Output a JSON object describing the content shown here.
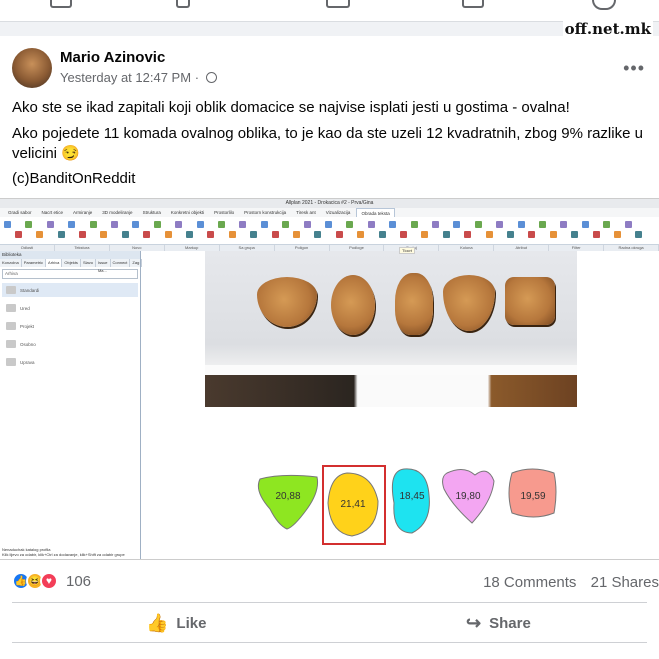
{
  "watermark": "off.net.mk",
  "post": {
    "author": "Mario Azinovic",
    "time": "Yesterday at 12:47 PM",
    "separator": "·",
    "more": "•••",
    "line1": "Ako ste se ikad zapitali koji oblik domacice se najvise isplati jesti u gostima - ovalna!",
    "line2": "Ako pojedete 11 komada ovalnog oblika, to je kao da ste uzeli 12 kvadratnih, zbog 9% razlike u velicini",
    "emoji": "😏",
    "line3": "(c)BanditOnReddit"
  },
  "screenshot": {
    "title": "Allplan 2021 - Drokacica #2 - Prva/Gina",
    "tabs": [
      "Gradi sabor",
      "Nacrt etice",
      "Armiranje",
      "3D modeliranje",
      "Struktura",
      "Konkretni objekti",
      "Prostorlilo",
      "Prostorn konstrukcija",
      "Tiresk ant",
      "Vizualizacija",
      "Obrada teksta"
    ],
    "active_tab_index": 10,
    "ribbon_groups": [
      "Odlosti",
      "Tekstura",
      "Novo",
      "Markup",
      "Sa grupa",
      "Poligon",
      "Podloge",
      "Dodaj",
      "Kolona",
      "Atribut",
      "Filter",
      "Radna okruga"
    ],
    "tooltip": "Tlocrt",
    "left_panel": {
      "header": "Biblioteka",
      "tabs": [
        "Konzolna",
        "Parametric",
        "Arhiva",
        "Objekts",
        "Slavo",
        "Issue Ma...",
        "Connect",
        "Zag"
      ],
      "active_tab_index": 2,
      "search_placeholder": "Arhiva",
      "items": [
        "Standardi",
        "Ured",
        "Projekt",
        "Osobno",
        "Uprava"
      ],
      "selected_index": 0,
      "footer_label": "Nenaduchak katalog profila",
      "status": "Klik lijevo za odabir, klik+Ctrl za dodavanje, klik+Shift za odabir grupe"
    },
    "shapes": [
      {
        "label": "20,88",
        "color": "#8ee621"
      },
      {
        "label": "21,41",
        "color": "#ffd21a"
      },
      {
        "label": "18,45",
        "color": "#1ee3f0"
      },
      {
        "label": "19,80",
        "color": "#f3a6f2"
      },
      {
        "label": "19,59",
        "color": "#f79a8e"
      }
    ],
    "selected_shape_index": 1
  },
  "reactions": {
    "count": "106",
    "types": [
      "like-icon",
      "haha-icon",
      "love-icon"
    ]
  },
  "stats": {
    "comments": "18 Comments",
    "shares": "21 Shares"
  },
  "actions": {
    "like": "Like",
    "share": "Share"
  }
}
